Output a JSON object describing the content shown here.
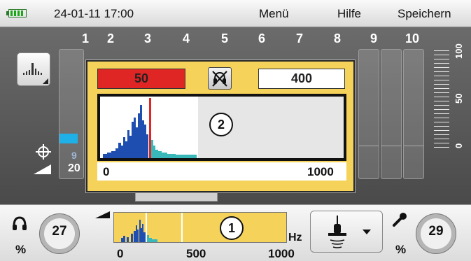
{
  "topbar": {
    "datetime": "24-01-11 17:00",
    "menu_label": "Menü",
    "help_label": "Hilfe",
    "save_label": "Speichern"
  },
  "channels": [
    "1",
    "2",
    "3",
    "4",
    "5",
    "6",
    "7",
    "8",
    "9",
    "10"
  ],
  "channel1": {
    "value_small": "9",
    "value_big": "20"
  },
  "scale": {
    "top": "100",
    "mid": "50",
    "bottom": "0"
  },
  "popup": {
    "red_value": "50",
    "white_value": "400",
    "marker": "2",
    "axis_min": "0",
    "axis_max": "1000"
  },
  "bottom": {
    "headphone_knob_value": "27",
    "headphone_unit": "%",
    "mic_knob_value": "29",
    "mic_unit": "%",
    "marker": "1",
    "hz_label": "Hz",
    "axis_0": "0",
    "axis_500": "500",
    "axis_1000": "1000"
  },
  "colors": {
    "accent_yellow": "#f5d35b",
    "red": "#e02525",
    "spectrum_blue": "#1e4fb0",
    "spectrum_teal": "#38b8b8",
    "level_cyan": "#1fb0e8"
  },
  "icons": [
    "battery-icon",
    "spectrum-view-icon",
    "crosshair-icon",
    "volume-ramp-icon",
    "mute-icon",
    "headphone-icon",
    "microphone-icon",
    "sensor-icon",
    "dropdown-arrow-icon"
  ]
}
